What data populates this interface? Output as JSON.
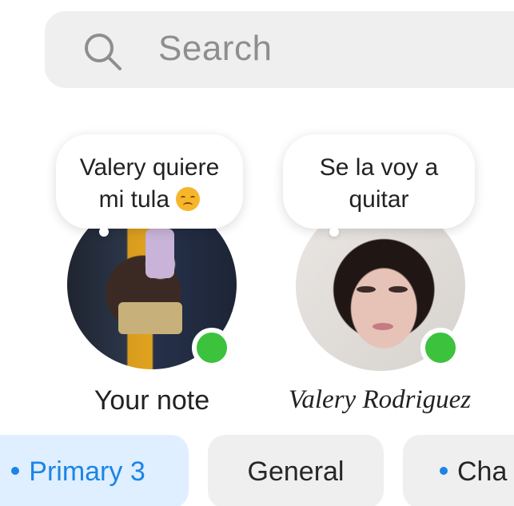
{
  "search": {
    "placeholder": "Search",
    "icon": "search-icon"
  },
  "notes": [
    {
      "bubble_line1": "Valery quiere",
      "bubble_line2": "mi tula",
      "emoji": "disappointed-face-emoji",
      "label": "Your note",
      "status": "online"
    },
    {
      "bubble_line1": "Se la voy a",
      "bubble_line2": "quitar",
      "label": "Valery Rodriguez",
      "status": "online"
    }
  ],
  "tabs": [
    {
      "label": "Primary 3",
      "active": true
    },
    {
      "label": "General",
      "active": false
    },
    {
      "label": "Cha",
      "active": false
    }
  ],
  "colors": {
    "accent": "#1c84e8",
    "online": "#3cc23c",
    "search_bg": "#efefef",
    "tab_active_bg": "#dfefff"
  }
}
